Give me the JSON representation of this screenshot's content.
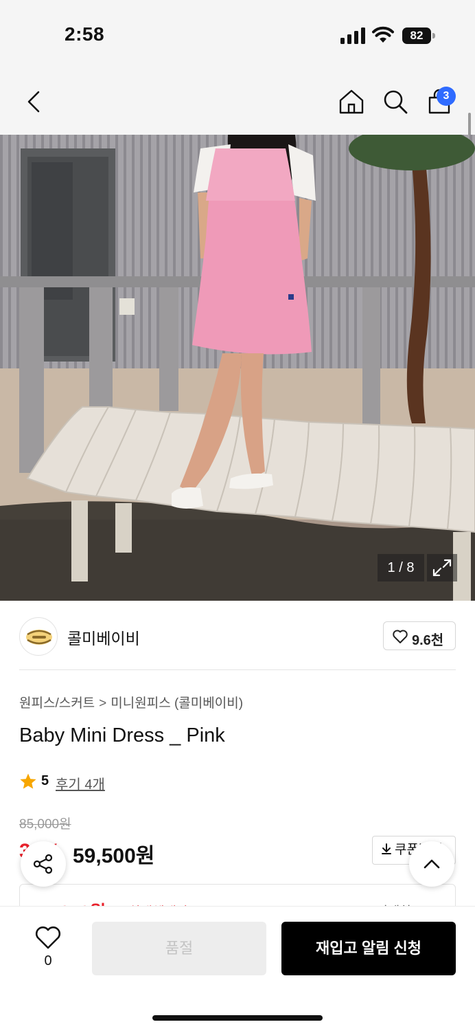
{
  "status_bar": {
    "time": "2:58",
    "battery": "82"
  },
  "nav": {
    "cart_count": "3"
  },
  "gallery": {
    "counter": "1 / 8"
  },
  "brand": {
    "name": "콜미베이비",
    "likes": "9.6천"
  },
  "product": {
    "breadcrumb_parent": "원피스/스커트",
    "breadcrumb_separator": ">",
    "breadcrumb_child": "미니원피스 (콜미베이비)",
    "title": "Baby Mini Dress _ Pink",
    "rating": "5",
    "review_link": "후기 4개",
    "original_price": "85,000원",
    "discount_rate": "30%",
    "sale_price": "59,500원",
    "coupon_label": "쿠폰받기",
    "max_benefit_price": "51,840원",
    "max_benefit_label": "최대혜택가",
    "benefit_detail": "자세히"
  },
  "bottom_bar": {
    "wish_count": "0",
    "soldout_label": "품절",
    "restock_label": "재입고 알림 신청"
  },
  "colors": {
    "accent_red": "#e8202a",
    "badge_blue": "#2f6bff",
    "primary_black": "#000000",
    "star": "#f7a600"
  }
}
